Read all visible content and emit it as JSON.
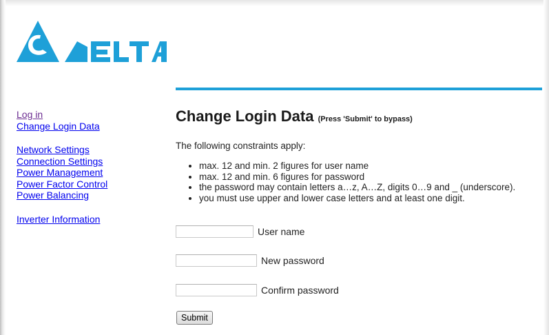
{
  "brand": {
    "name": "DELTA",
    "color": "#1ea0d8"
  },
  "sidebar": {
    "groups": [
      [
        {
          "label": "Log in",
          "visited": true
        },
        {
          "label": "Change Login Data"
        }
      ],
      [
        {
          "label": "Network Settings"
        },
        {
          "label": "Connection Settings"
        },
        {
          "label": "Power Management"
        },
        {
          "label": "Power Factor Control"
        },
        {
          "label": "Power Balancing"
        }
      ],
      [
        {
          "label": "Inverter Information"
        }
      ]
    ]
  },
  "main": {
    "title": "Change Login Data",
    "title_note": "(Press 'Submit' to bypass)",
    "intro": "The following constraints apply:",
    "constraints": [
      "max. 12 and min. 2 figures for user name",
      "max. 12 and min. 6 figures for password",
      "the password may contain letters a…z, A…Z, digits 0…9 and _ (underscore).",
      "you must use upper and lower case letters and at least one digit."
    ]
  },
  "form": {
    "username": {
      "label": "User name",
      "value": ""
    },
    "new_password": {
      "label": "New password",
      "value": ""
    },
    "confirm_password": {
      "label": "Confirm password",
      "value": ""
    },
    "submit_label": "Submit"
  }
}
